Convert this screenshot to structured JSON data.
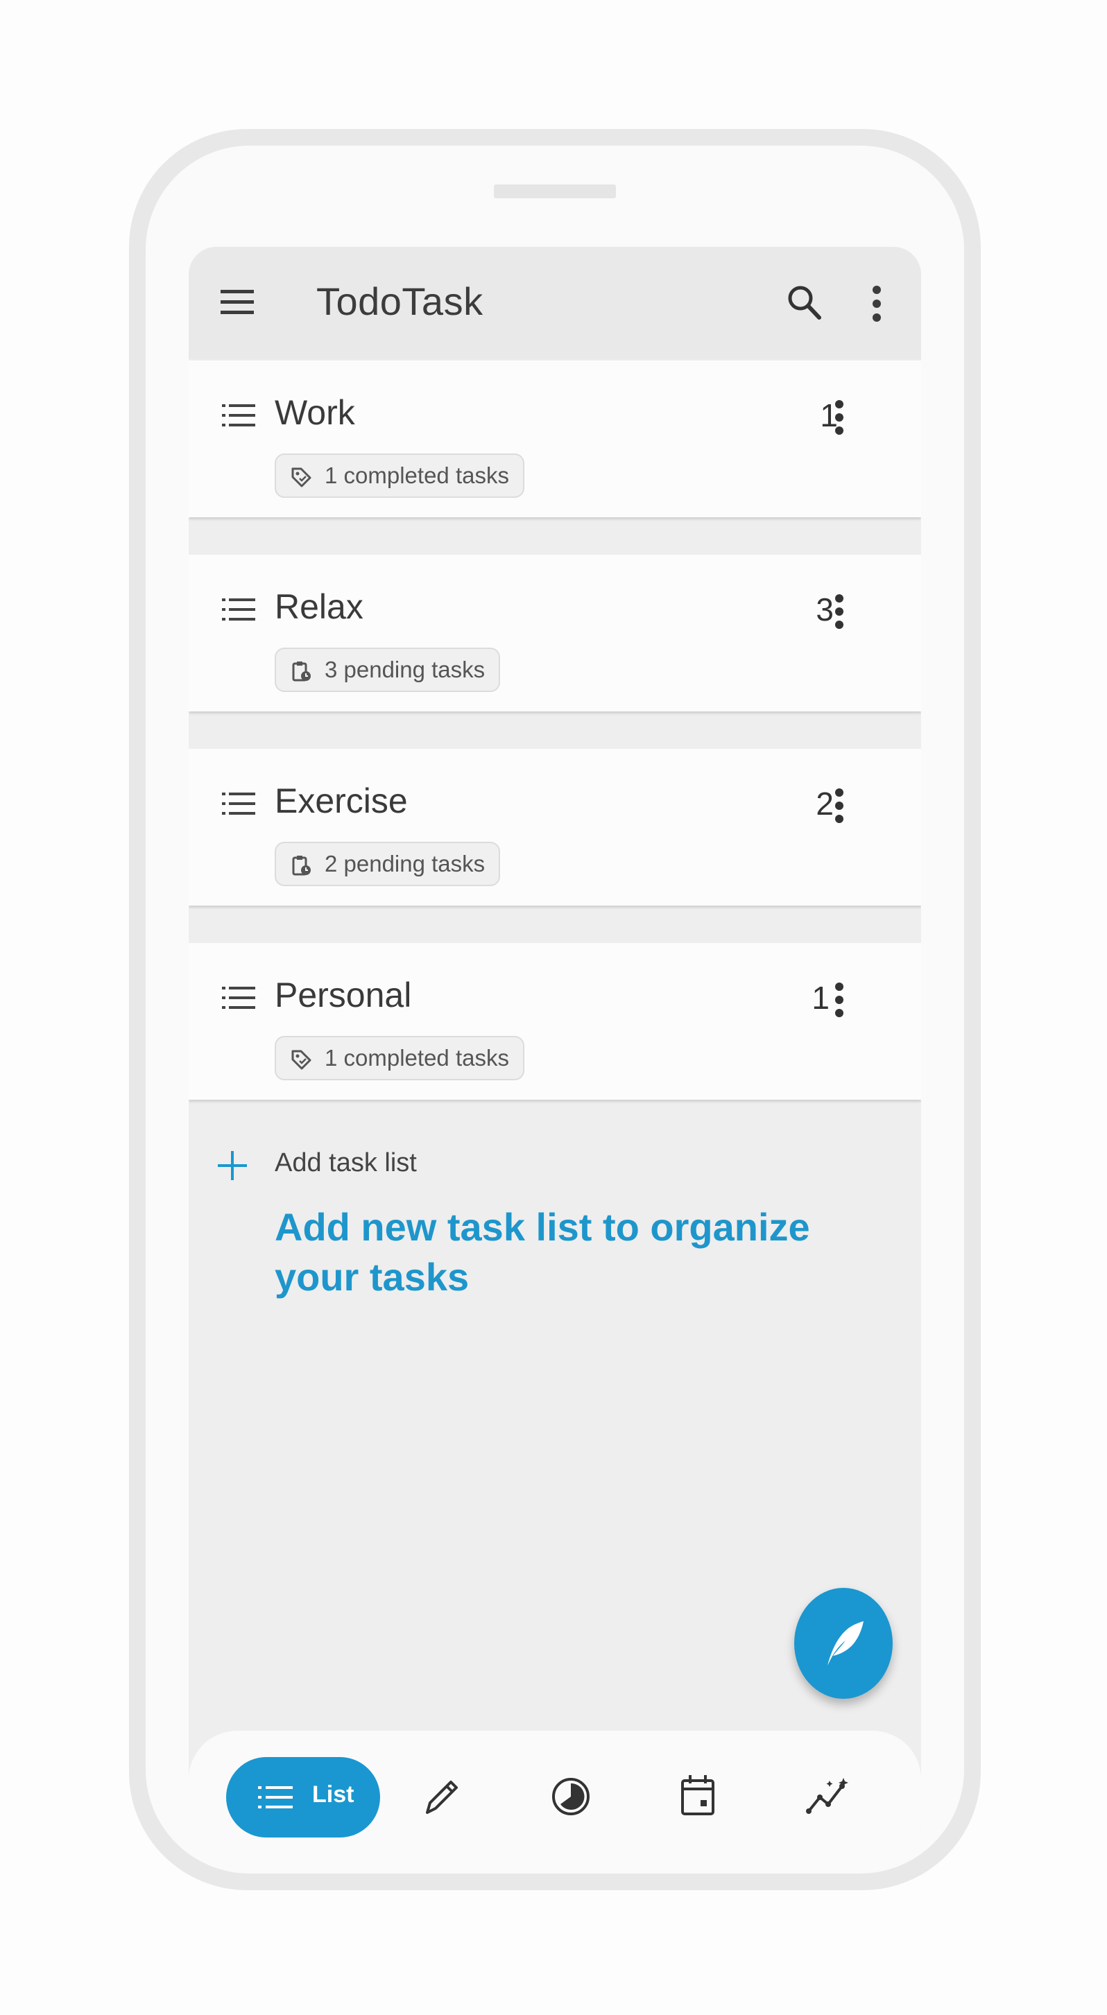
{
  "app": {
    "title": "TodoTask"
  },
  "appbar": {
    "menu_icon": "hamburger-menu-icon",
    "search_icon": "search-icon",
    "more_icon": "more-vert-icon"
  },
  "task_lists": [
    {
      "name": "Work",
      "count": "1",
      "chip_icon": "tag-icon",
      "chip_text": "1 completed tasks"
    },
    {
      "name": "Relax",
      "count": "3",
      "chip_icon": "clipboard-clock-icon",
      "chip_text": "3 pending tasks"
    },
    {
      "name": "Exercise",
      "count": "2",
      "chip_icon": "clipboard-clock-icon",
      "chip_text": "2 pending tasks"
    },
    {
      "name": "Personal",
      "count": "1",
      "chip_icon": "tag-icon",
      "chip_text": "1 completed tasks"
    }
  ],
  "add_task_list": {
    "label": "Add task list",
    "description": "Add new task list to organize your tasks"
  },
  "fab": {
    "icon": "feather-icon"
  },
  "bottom_nav": {
    "active_label": "List",
    "items": [
      "list-icon",
      "pencil-icon",
      "pie-chart-icon",
      "calendar-icon",
      "analytics-icon"
    ]
  },
  "colors": {
    "accent": "#1a97d0",
    "accent_text": "#1e96cc",
    "background": "#eeeeee",
    "card": "#fcfcfc"
  }
}
